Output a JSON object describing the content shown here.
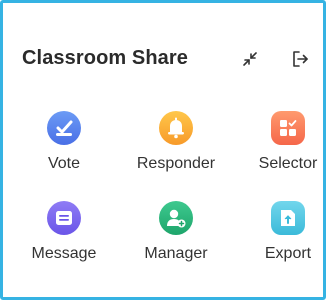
{
  "window": {
    "title": "Classroom Share",
    "accent_border": "#35b3e3"
  },
  "header": {
    "collapse_icon": "collapse-arrows-icon",
    "exit_icon": "exit-icon"
  },
  "tools": [
    {
      "label": "Vote",
      "icon": "vote-icon",
      "color_top": "#6c9bf5",
      "color_bottom": "#4a6fe6"
    },
    {
      "label": "Responder",
      "icon": "bell-icon",
      "color_top": "#ffc74a",
      "color_bottom": "#f79a2a"
    },
    {
      "label": "Selector",
      "icon": "selector-icon",
      "color_top": "#ff9a6e",
      "color_bottom": "#f5674a"
    },
    {
      "label": "Message",
      "icon": "message-icon",
      "color_top": "#8f7cf5",
      "color_bottom": "#6a55e8"
    },
    {
      "label": "Manager",
      "icon": "manager-icon",
      "color_top": "#3ec98f",
      "color_bottom": "#1ea56b"
    },
    {
      "label": "Export",
      "icon": "export-icon",
      "color_top": "#72d6ec",
      "color_bottom": "#3bbad9"
    }
  ]
}
